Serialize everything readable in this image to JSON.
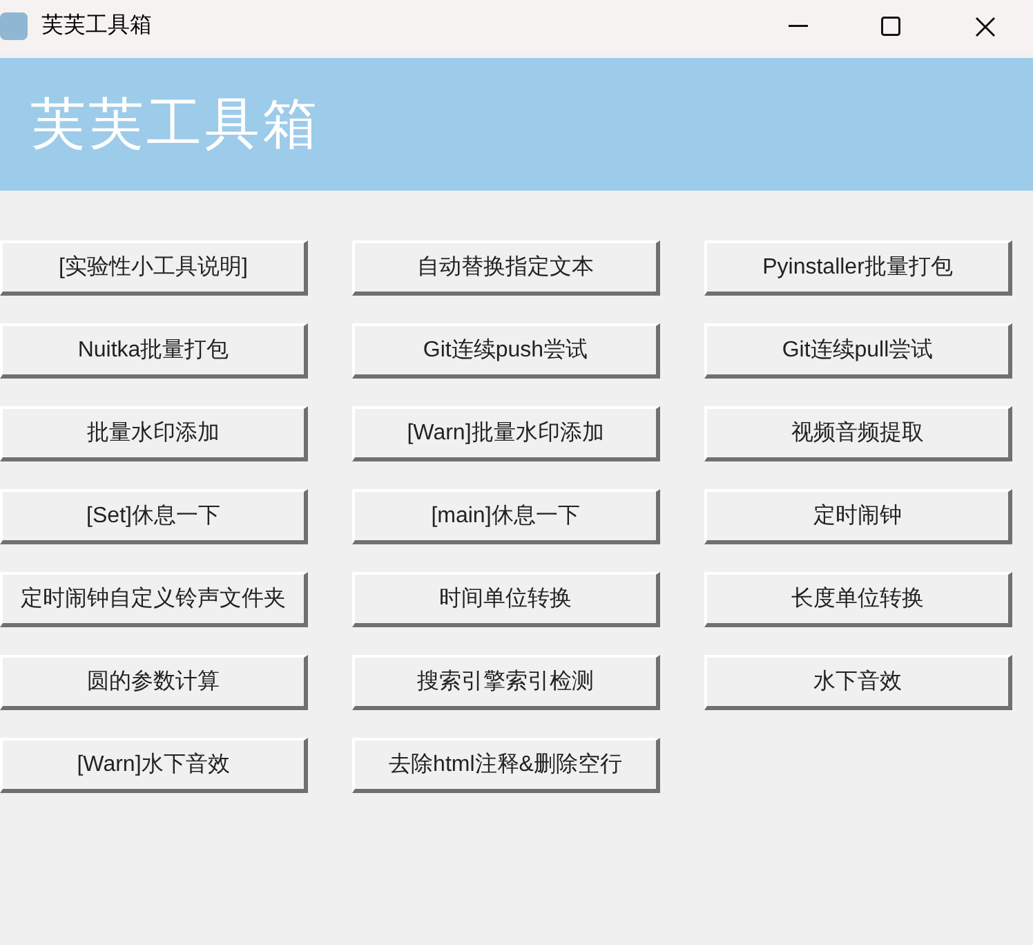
{
  "window": {
    "title": "芙芙工具箱"
  },
  "header": {
    "title": "芙芙工具箱"
  },
  "buttons": [
    "[实验性小工具说明]",
    "自动替换指定文本",
    "Pyinstaller批量打包",
    "Nuitka批量打包",
    "Git连续push尝试",
    "Git连续pull尝试",
    "批量水印添加",
    "[Warn]批量水印添加",
    "视频音频提取",
    "[Set]休息一下",
    "[main]休息一下",
    "定时闹钟",
    "定时闹钟自定义铃声文件夹",
    "时间单位转换",
    "长度单位转换",
    "圆的参数计算",
    "搜索引擎索引检测",
    "水下音效",
    "[Warn]水下音效",
    "去除html注释&删除空行"
  ]
}
